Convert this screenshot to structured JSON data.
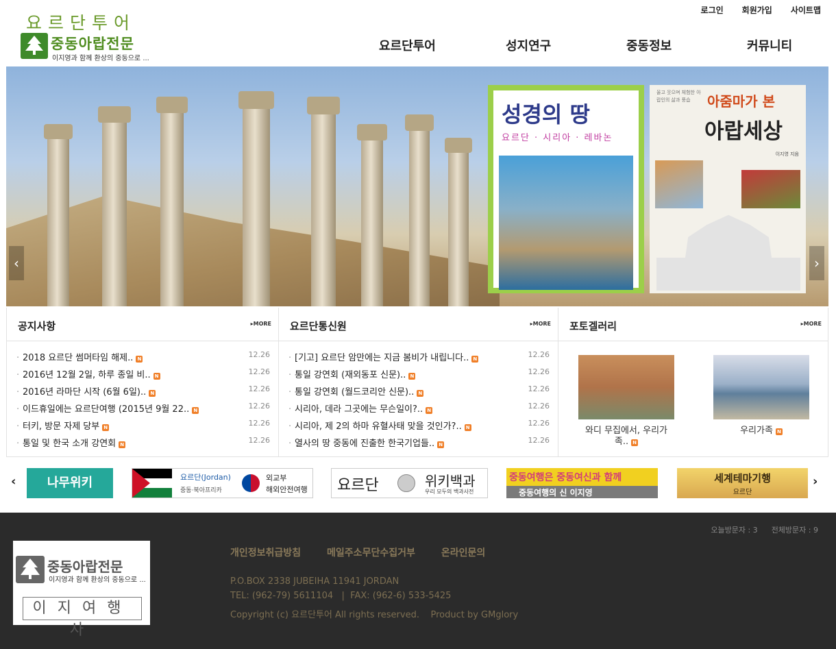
{
  "header": {
    "logo_title": "요르단투어",
    "logo_name": "중동아랍전문",
    "logo_slogan": "이지영과 함께 환상의 중동으로 ...",
    "util": [
      "로그인",
      "회원가입",
      "사이트맵"
    ],
    "nav": [
      "요르단투어",
      "성지연구",
      "중동정보",
      "커뮤니티"
    ]
  },
  "banner": {
    "book1_title": "성경의 땅",
    "book1_sub": "요르단 · 시리아 · 레바논",
    "book2_small": "울고 웃으며 체험한 아랍인의 삶과 풍습",
    "book2_title1": "아줌마가 본",
    "book2_title2": "아랍세상",
    "book2_author": "이지영 지음"
  },
  "notice": {
    "title": "공지사항",
    "more": "MORE",
    "items": [
      {
        "text": "2018 요르단 썸머타임 해제..",
        "date": "12.26"
      },
      {
        "text": "2016년 12월 2일, 하루 종일 비..",
        "date": "12.26"
      },
      {
        "text": "2016년 라마단 시작 (6월 6일)..",
        "date": "12.26"
      },
      {
        "text": "이드휴일에는 요르단여행 (2015년 9월 22..",
        "date": "12.26"
      },
      {
        "text": "터키, 방문 자제 당부",
        "date": "12.26"
      },
      {
        "text": "통일 및 한국 소개 강연회",
        "date": "12.26"
      }
    ]
  },
  "correspondent": {
    "title": "요르단통신원",
    "more": "MORE",
    "items": [
      {
        "text": "[기고] 요르단 암만에는 지금 봄비가 내립니다..",
        "date": "12.26"
      },
      {
        "text": "통일 강연회 (재외동포 신문)..",
        "date": "12.26"
      },
      {
        "text": "통일 강연회 (월드코리안 신문)..",
        "date": "12.26"
      },
      {
        "text": "시리아, 데라 그곳에는 무슨일이?..",
        "date": "12.26"
      },
      {
        "text": "시리아, 제 2의 하마 유혈사태 맞을 것인가?..",
        "date": "12.26"
      },
      {
        "text": "열사의 땅 중동에 진출한 한국기업들..",
        "date": "12.26"
      }
    ]
  },
  "gallery": {
    "title": "포토겔러리",
    "more": "MORE",
    "items": [
      {
        "caption1": "와디 무집에서, 우리가",
        "caption2": "족.."
      },
      {
        "caption1": "우리가족",
        "caption2": ""
      }
    ]
  },
  "new_badge": "N",
  "links": {
    "namu": "나무위키",
    "jordan_label": "요르단(Jordan)",
    "jordan_sub": "중동·북아프리카",
    "mofa1": "외교부",
    "mofa2": "해외안전여행",
    "wiki_left": "요르단",
    "wiki_right": "위키백과",
    "wiki_sub": "우리 모두의 백과사전",
    "travel1": "중동여행은 중동여신과 함께",
    "travel2": "중동여행의 신 이지영",
    "theme1": "세계테마기행",
    "theme2": "요르단"
  },
  "footer": {
    "visitors_today": "오늘방문자 : 3",
    "visitors_total": "전체방문자 : 9",
    "logo_name": "중동아랍전문",
    "logo_slogan": "이지영과 함께 환상의 중동으로 ...",
    "logo_sign": "이지여행사",
    "links": [
      "개인정보취급방침",
      "메일주소무단수집거부",
      "온라인문의"
    ],
    "address": "P.O.BOX 2338 JUBEIHA 11941 JORDAN",
    "tel": "TEL: (962-79) 5611104   |  FAX: (962-6) 533-5425",
    "copyright": "Copyright (c) 요르단투어 All rights reserved.    Product by GMglory"
  }
}
